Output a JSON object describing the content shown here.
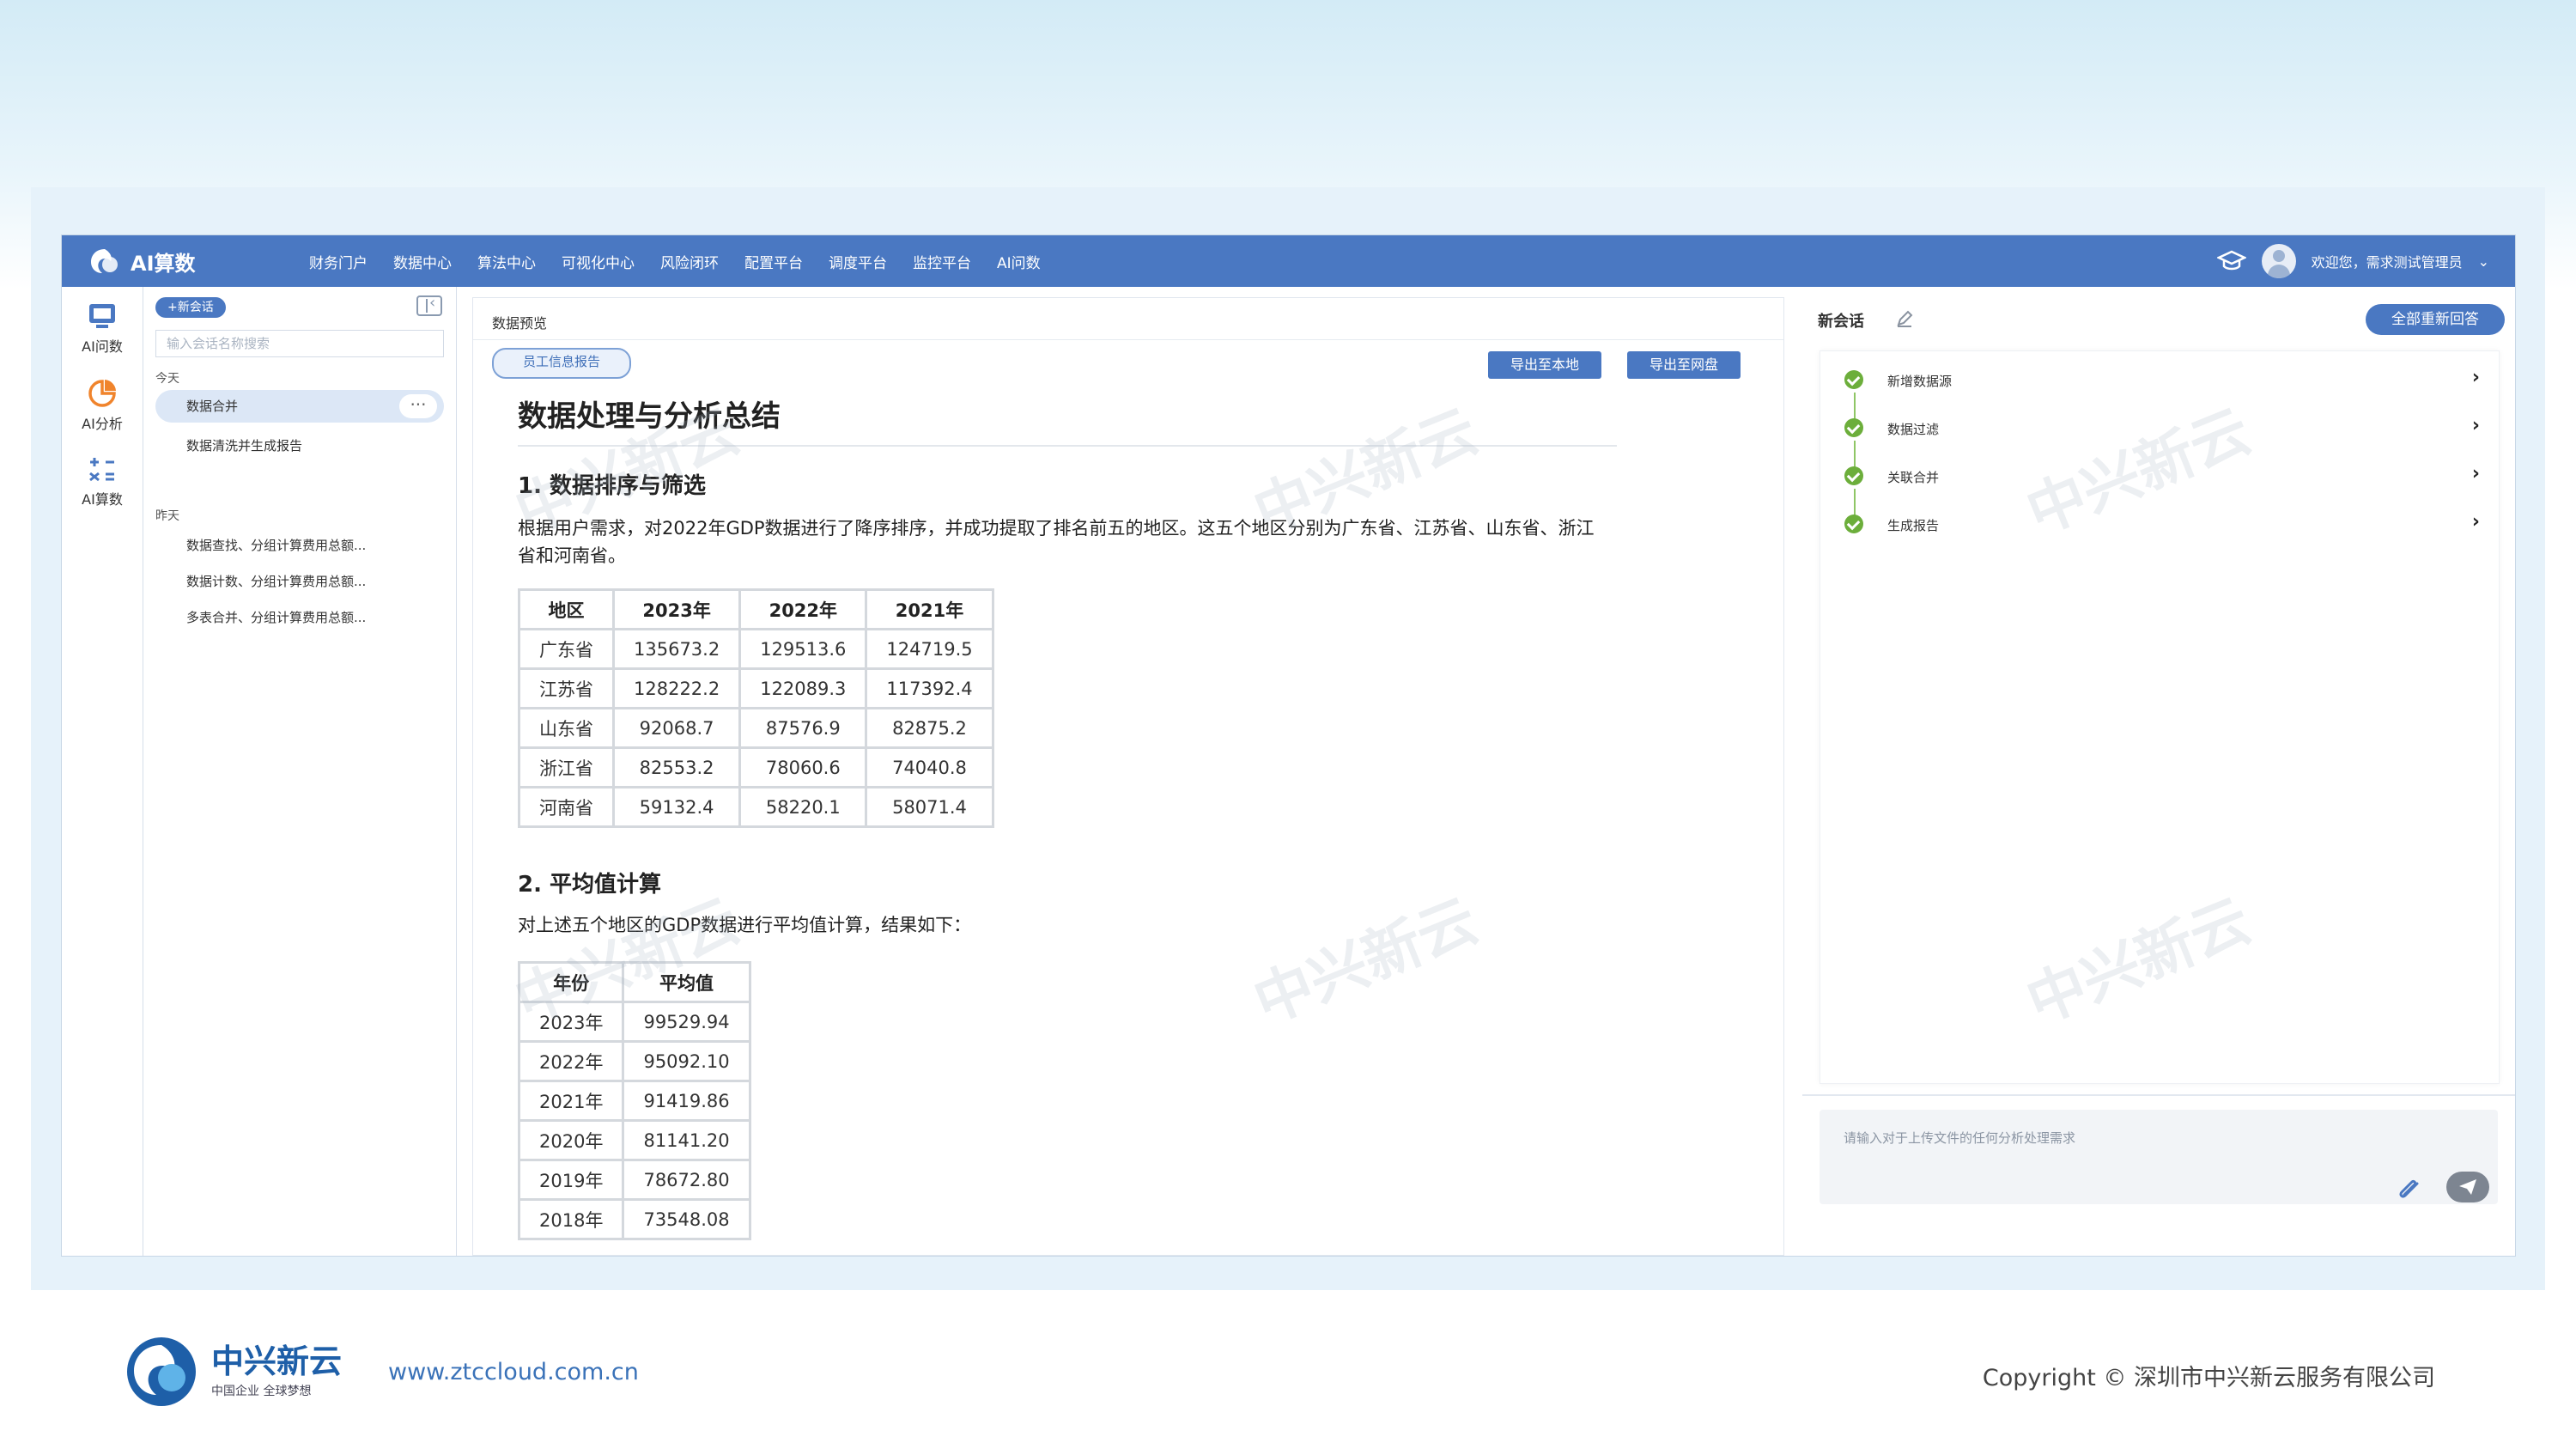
{
  "app": {
    "name": "AI算数",
    "nav": [
      "财务门户",
      "数据中心",
      "算法中心",
      "可视化中心",
      "风险闭环",
      "配置平台",
      "调度平台",
      "监控平台",
      "AI问数"
    ],
    "user_greeting": "欢迎您，需求测试管理员"
  },
  "rail": [
    {
      "label": "AI问数",
      "icon": "chat-monitor-icon"
    },
    {
      "label": "AI分析",
      "icon": "pie-chart-icon"
    },
    {
      "label": "AI算数",
      "icon": "calculator-icon"
    }
  ],
  "sessions": {
    "new_label": "+新会话",
    "search_placeholder": "输入会话名称搜索",
    "today_label": "今天",
    "today": [
      "数据合并",
      "数据清洗并生成报告"
    ],
    "yesterday_label": "昨天",
    "yesterday": [
      "数据查找、分组计算费用总额...",
      "数据计数、分组计算费用总额...",
      "多表合并、分组计算费用总额..."
    ]
  },
  "preview": {
    "title": "数据预览",
    "file_tag": "员工信息报告",
    "export_local": "导出至本地",
    "export_cloud": "导出至网盘",
    "doc_title": "数据处理与分析总结",
    "section1_title": "1. 数据排序与筛选",
    "section1_text": "根据用户需求，对2022年GDP数据进行了降序排序，并成功提取了排名前五的地区。这五个地区分别为广东省、江苏省、山东省、浙江省和河南省。",
    "table1": {
      "headers": [
        "地区",
        "2023年",
        "2022年",
        "2021年"
      ],
      "rows": [
        [
          "广东省",
          "135673.2",
          "129513.6",
          "124719.5"
        ],
        [
          "江苏省",
          "128222.2",
          "122089.3",
          "117392.4"
        ],
        [
          "山东省",
          "92068.7",
          "87576.9",
          "82875.2"
        ],
        [
          "浙江省",
          "82553.2",
          "78060.6",
          "74040.8"
        ],
        [
          "河南省",
          "59132.4",
          "58220.1",
          "58071.4"
        ]
      ]
    },
    "section2_title": "2. 平均值计算",
    "section2_text": "对上述五个地区的GDP数据进行平均值计算，结果如下：",
    "table2": {
      "headers": [
        "年份",
        "平均值"
      ],
      "rows": [
        [
          "2023年",
          "99529.94"
        ],
        [
          "2022年",
          "95092.10"
        ],
        [
          "2021年",
          "91419.86"
        ],
        [
          "2020年",
          "81141.20"
        ],
        [
          "2019年",
          "78672.80"
        ],
        [
          "2018年",
          "73548.08"
        ]
      ]
    }
  },
  "chat": {
    "title": "新会话",
    "regenerate": "全部重新回答",
    "steps": [
      "新增数据源",
      "数据过滤",
      "关联合并",
      "生成报告"
    ],
    "input_placeholder": "请输入对于上传文件的任何分析处理需求"
  },
  "watermark": "中兴新云",
  "footer": {
    "brand": "中兴新云",
    "slogan": "中国企业 全球梦想",
    "url": "www.ztccloud.com.cn",
    "copyright": "Copyright © 深圳市中兴新云服务有限公司"
  },
  "colors": {
    "primary": "#4a78c2",
    "success": "#6cae3b",
    "brand": "#1e5fa8"
  }
}
